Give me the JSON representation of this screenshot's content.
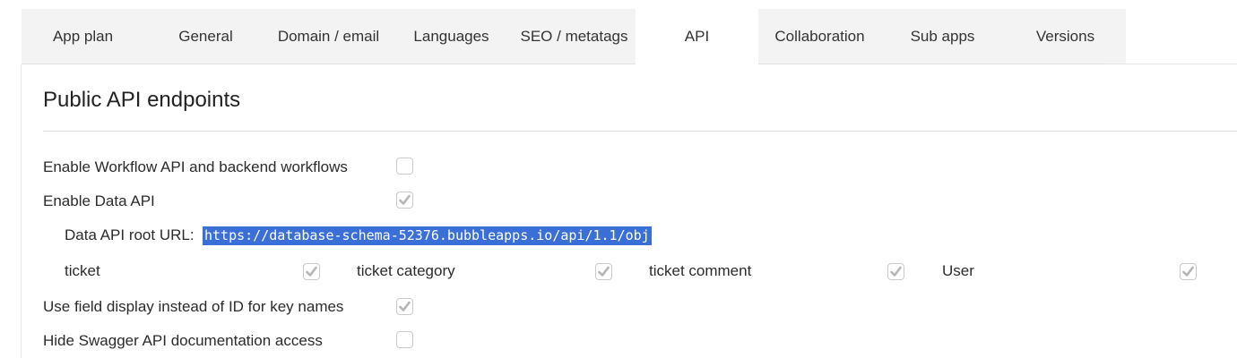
{
  "tabs": [
    {
      "label": "App plan"
    },
    {
      "label": "General"
    },
    {
      "label": "Domain / email"
    },
    {
      "label": "Languages"
    },
    {
      "label": "SEO / metatags"
    },
    {
      "label": "API"
    },
    {
      "label": "Collaboration"
    },
    {
      "label": "Sub apps"
    },
    {
      "label": "Versions"
    }
  ],
  "active_tab": "API",
  "section": {
    "title": "Public API endpoints"
  },
  "settings": {
    "workflow_api": {
      "label": "Enable Workflow API and backend workflows",
      "checked": false
    },
    "data_api": {
      "label": "Enable Data API",
      "checked": true
    },
    "root_url": {
      "label": "Data API root URL:",
      "value": "https://database-schema-52376.bubbleapps.io/api/1.1/obj"
    },
    "types": [
      {
        "label": "ticket",
        "checked": true
      },
      {
        "label": "ticket category",
        "checked": true
      },
      {
        "label": "ticket comment",
        "checked": true
      },
      {
        "label": "User",
        "checked": true
      }
    ],
    "field_display": {
      "label": "Use field display instead of ID for key names",
      "checked": true
    },
    "hide_swagger": {
      "label": "Hide Swagger API documentation access",
      "checked": false
    }
  },
  "colors": {
    "selection": "#3a6fd8",
    "check": "#b5b5b5",
    "tab_bg": "#f3f3f3"
  }
}
